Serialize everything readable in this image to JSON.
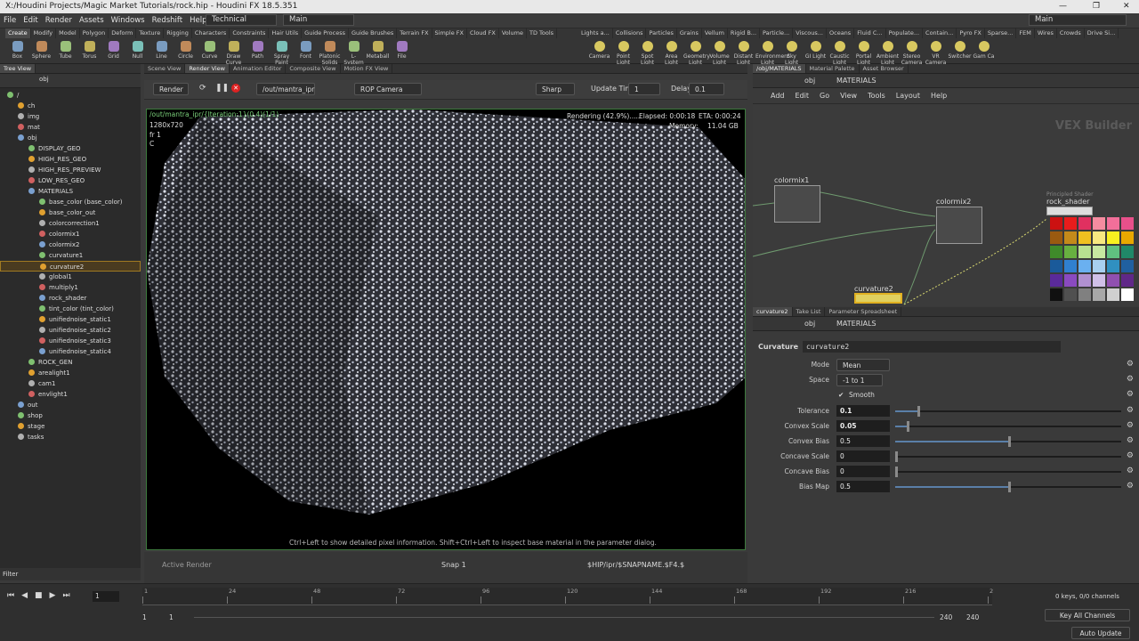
{
  "window": {
    "title": "X:/Houdini Projects/Magic Market Tutorials/rock.hip - Houdini FX 18.5.351"
  },
  "menubar": {
    "items": [
      "File",
      "Edit",
      "Render",
      "Assets",
      "Windows",
      "Redshift",
      "Help"
    ],
    "desktop": "Technical",
    "workspace": "Main"
  },
  "shelf_left": {
    "tabs": [
      "Create",
      "Modify",
      "Model",
      "Polygon",
      "Deform",
      "Texture",
      "Rigging",
      "Characters",
      "Constraints",
      "Hair Utils",
      "Guide Process",
      "Guide Brushes",
      "Terrain FX",
      "Simple FX",
      "Cloud FX",
      "Volume",
      "TD Tools"
    ],
    "tools": [
      "Box",
      "Sphere",
      "Tube",
      "Torus",
      "Grid",
      "Null",
      "Line",
      "Circle",
      "Curve",
      "Draw Curve",
      "Path",
      "Spray Paint",
      "Font",
      "Platonic Solids",
      "L-System",
      "Metaball",
      "File"
    ]
  },
  "shelf_right": {
    "tabs": [
      "Lights a...",
      "Collisions",
      "Particles",
      "Grains",
      "Vellum",
      "Rigid B...",
      "Particle...",
      "Viscous...",
      "Oceans",
      "Fluid C...",
      "Populate...",
      "Contain...",
      "Pyro FX",
      "Sparse...",
      "FEM",
      "Wires",
      "Crowds",
      "Drive Si..."
    ],
    "tools": [
      "Camera",
      "Point Light",
      "Spot Light",
      "Area Light",
      "Geometry Light",
      "Volume Light",
      "Distant Light",
      "Environment Light",
      "Sky Light",
      "GI Light",
      "Caustic Light",
      "Portal Light",
      "Ambient Light",
      "Stereo Camera",
      "VR Camera",
      "Switcher",
      "Gam Ca"
    ]
  },
  "tree": {
    "tab": "Tree View",
    "path": "obj",
    "rows": [
      {
        "label": "/",
        "indent": 0
      },
      {
        "label": "ch",
        "indent": 1
      },
      {
        "label": "img",
        "indent": 1
      },
      {
        "label": "mat",
        "indent": 1
      },
      {
        "label": "obj",
        "indent": 1
      },
      {
        "label": "DISPLAY_GEO",
        "indent": 2
      },
      {
        "label": "HIGH_RES_GEO",
        "indent": 2
      },
      {
        "label": "HIGH_RES_PREVIEW",
        "indent": 2
      },
      {
        "label": "LOW_RES_GEO",
        "indent": 2
      },
      {
        "label": "MATERIALS",
        "indent": 2
      },
      {
        "label": "base_color (base_color)",
        "indent": 3
      },
      {
        "label": "base_color_out",
        "indent": 3
      },
      {
        "label": "colorcorrection1",
        "indent": 3
      },
      {
        "label": "colormix1",
        "indent": 3
      },
      {
        "label": "colormix2",
        "indent": 3
      },
      {
        "label": "curvature1",
        "indent": 3
      },
      {
        "label": "curvature2",
        "indent": 3,
        "selected": true
      },
      {
        "label": "global1",
        "indent": 3
      },
      {
        "label": "multiply1",
        "indent": 3
      },
      {
        "label": "rock_shader",
        "indent": 3
      },
      {
        "label": "tint_color (tint_color)",
        "indent": 3
      },
      {
        "label": "unifiednoise_static1",
        "indent": 3
      },
      {
        "label": "unifiednoise_static2",
        "indent": 3
      },
      {
        "label": "unifiednoise_static3",
        "indent": 3
      },
      {
        "label": "unifiednoise_static4",
        "indent": 3
      },
      {
        "label": "ROCK_GEN",
        "indent": 2
      },
      {
        "label": "arealight1",
        "indent": 2
      },
      {
        "label": "cam1",
        "indent": 2
      },
      {
        "label": "envlight1",
        "indent": 2
      },
      {
        "label": "out",
        "indent": 1
      },
      {
        "label": "shop",
        "indent": 1
      },
      {
        "label": "stage",
        "indent": 1
      },
      {
        "label": "tasks",
        "indent": 1
      }
    ],
    "filter_label": "Filter"
  },
  "viewer": {
    "tabs": [
      "Scene View",
      "Render View",
      "Animation Editor",
      "Composite View",
      "Motion FX View"
    ],
    "render_btn": "Render",
    "rop_path": "/out/mantra_ipr",
    "camera": "ROP Camera",
    "sharp": "Sharp",
    "update_label": "Update Time",
    "update_val": "1",
    "delay_label": "Delay",
    "delay_val": "0.1",
    "overlay_path": "/out/mantra_ipr/{Iteration:1}(0.4)(1/1)",
    "resolution": "1280x720",
    "fr": "fr 1",
    "c": "C",
    "rendering": "Rendering (42.9%).....",
    "elapsed": "Elapsed: 0:00:18",
    "eta": "ETA: 0:00:24",
    "memory_label": "Memory:",
    "memory": "11.04 GB",
    "hint": "Ctrl+Left to show detailed pixel information. Shift+Ctrl+Left to inspect base material in the parameter dialog.",
    "active_render": "Active Render",
    "snap": "Snap 1",
    "snap_path": "$HIP/ipr/$SNAPNAME.$F4.$"
  },
  "network": {
    "tabs": [
      "/obj/MATERIALS",
      "Material Palette",
      "Asset Browser"
    ],
    "path": [
      "obj",
      "MATERIALS"
    ],
    "menu": [
      "Add",
      "Edit",
      "Go",
      "View",
      "Tools",
      "Layout",
      "Help"
    ],
    "title": "VEX Builder",
    "nodes": [
      "colormix1",
      "colormix2",
      "rock_shader",
      "curvature2"
    ],
    "shader_type": "Principled Shader"
  },
  "palette": [
    "#cc1111",
    "#e81c1c",
    "#e03060",
    "#f58ca0",
    "#f26f9a",
    "#e8508a",
    "#9a5a10",
    "#c48a1a",
    "#f0c020",
    "#f8e880",
    "#f8f020",
    "#e8a800",
    "#3f8a2a",
    "#68b040",
    "#b8e090",
    "#c8e8a0",
    "#60c080",
    "#208868",
    "#1a5a9a",
    "#3080d0",
    "#6ab0f0",
    "#a8d0f0",
    "#3090c0",
    "#2060a0",
    "#5a2a9a",
    "#8a4ac0",
    "#b090d0",
    "#d0c0e8",
    "#9050b0",
    "#602888",
    "#101010",
    "#505050",
    "#808080",
    "#a8a8a8",
    "#d0d0d0",
    "#ffffff"
  ],
  "params": {
    "tabs": [
      "curvature2",
      "Take List",
      "Parameter Spreadsheet"
    ],
    "path": [
      "obj",
      "MATERIALS"
    ],
    "type": "Curvature",
    "name": "curvature2",
    "mode_label": "Mode",
    "mode": "Mean",
    "space_label": "Space",
    "space": "-1 to 1",
    "smooth": "Smooth",
    "rows": [
      {
        "label": "Tolerance",
        "value": "0.1",
        "frac": 0.1
      },
      {
        "label": "Convex Scale",
        "value": "0.05",
        "frac": 0.05
      },
      {
        "label": "Convex Bias",
        "value": "0.5",
        "frac": 0.5
      },
      {
        "label": "Concave Scale",
        "value": "0",
        "frac": 0
      },
      {
        "label": "Concave Bias",
        "value": "0",
        "frac": 0
      },
      {
        "label": "Bias Map",
        "value": "0.5",
        "frac": 0.5
      }
    ]
  },
  "timeline": {
    "frame": "1",
    "ticks": [
      "1",
      "24",
      "48",
      "72",
      "96",
      "120",
      "144",
      "168",
      "192",
      "216",
      "2"
    ],
    "start": "1",
    "start2": "1",
    "end": "240",
    "end2": "240",
    "keys": "0 keys, 0/0 channels",
    "key_all": "Key All Channels",
    "auto_update": "Auto Update"
  }
}
